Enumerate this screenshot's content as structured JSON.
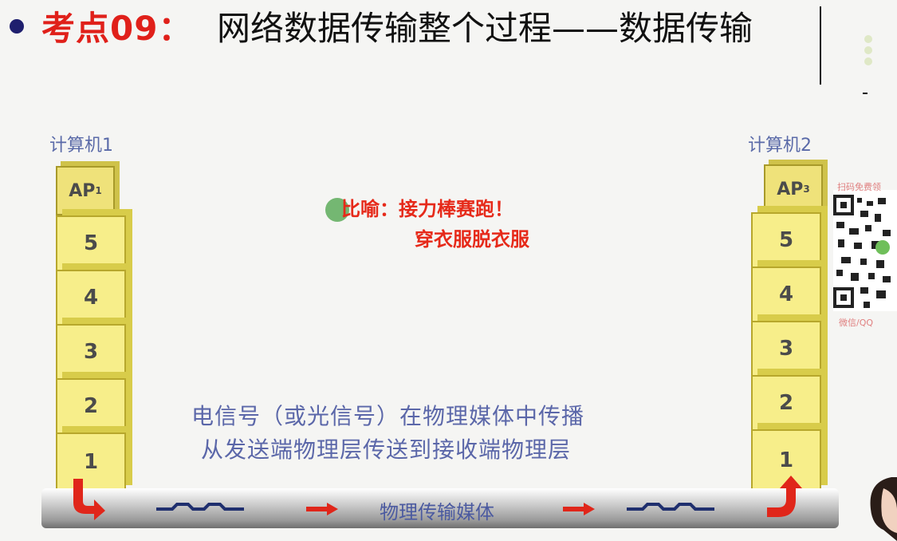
{
  "title": {
    "prefix": "考点09：",
    "main": "网络数据传输整个过程——数据传输"
  },
  "computers": {
    "left_label": "计算机1",
    "right_label": "计算机2",
    "left_ap": "AP",
    "left_ap_sub": "1",
    "right_ap": "AP",
    "right_ap_sub": "3",
    "layers": [
      "5",
      "4",
      "3",
      "2",
      "1"
    ]
  },
  "metaphor": {
    "line1": "比喻：接力棒赛跑！",
    "line2": "穿衣服脱衣服"
  },
  "description": {
    "line1": "电信号（或光信号）在物理媒体中传播",
    "line2": "从发送端物理层传送到接收端物理层"
  },
  "pipe_label": "物理传输媒体",
  "overlay": {
    "qr_top": "扫码免费领",
    "qr_bottom": "微信/QQ"
  },
  "colors": {
    "title_red": "#e0201a",
    "box_fill": "#f7ee8a",
    "label_blue": "#5b67a9",
    "arrow_red": "#e0261a"
  }
}
